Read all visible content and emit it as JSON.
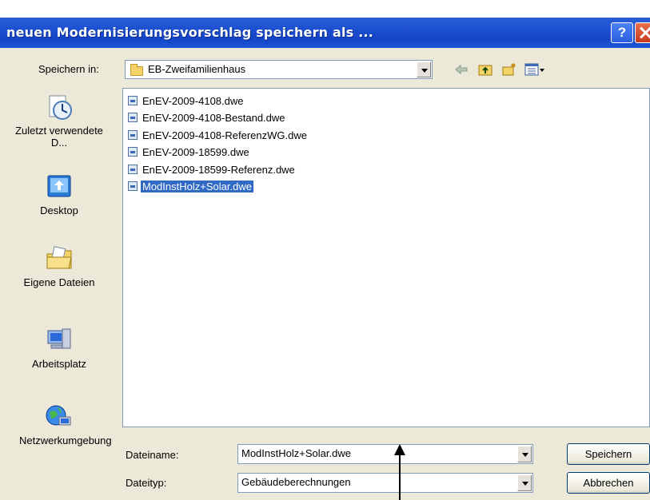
{
  "dialog": {
    "title": "neuen Modernisierungsvorschlag speichern als ...",
    "help_label": "?"
  },
  "save_in": {
    "label": "Speichern in:",
    "value": "EB-Zweifamilienhaus",
    "folder_icon": "folder-icon"
  },
  "toolbar": {
    "icons": [
      "back-arrow-icon",
      "up-folder-icon",
      "new-folder-icon",
      "view-menu-icon"
    ]
  },
  "places": [
    {
      "label": "Zuletzt verwendete D...",
      "icon": "recent-documents-icon"
    },
    {
      "label": "Desktop",
      "icon": "desktop-icon"
    },
    {
      "label": "Eigene Dateien",
      "icon": "my-documents-icon"
    },
    {
      "label": "Arbeitsplatz",
      "icon": "my-computer-icon"
    },
    {
      "label": "Netzwerkumgebung",
      "icon": "network-icon"
    }
  ],
  "files": [
    {
      "name": "EnEV-2009-4108.dwe",
      "selected": false
    },
    {
      "name": "EnEV-2009-4108-Bestand.dwe",
      "selected": false
    },
    {
      "name": "EnEV-2009-4108-ReferenzWG.dwe",
      "selected": false
    },
    {
      "name": "EnEV-2009-18599.dwe",
      "selected": false
    },
    {
      "name": "EnEV-2009-18599-Referenz.dwe",
      "selected": false
    },
    {
      "name": "ModInstHolz+Solar.dwe",
      "selected": true
    }
  ],
  "filename": {
    "label": "Dateiname:",
    "value": "ModInstHolz+Solar.dwe"
  },
  "filetype": {
    "label": "Dateityp:",
    "value": "Gebäudeberechnungen"
  },
  "buttons": {
    "save": "Speichern",
    "cancel": "Abbrechen"
  },
  "colors": {
    "title_bar": "#1b4fd0",
    "selection": "#316ac5",
    "dialog_bg": "#ece9d8"
  }
}
